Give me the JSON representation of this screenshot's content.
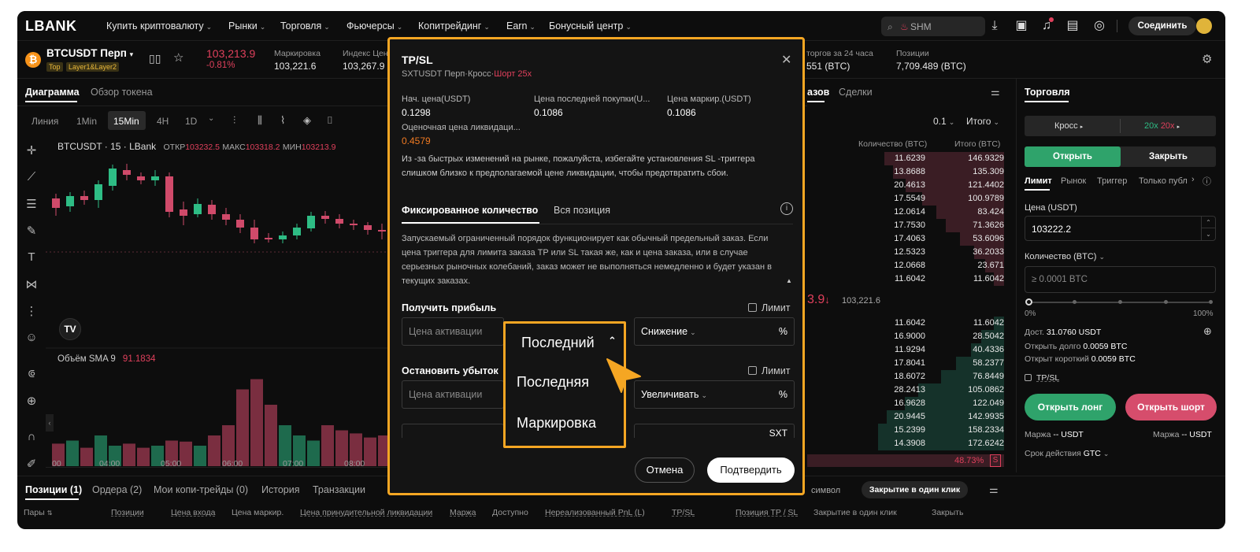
{
  "nav": {
    "logo": "LBANK",
    "items": [
      "Купить криптовалюту",
      "Рынки",
      "Торговля",
      "Фьючерсы",
      "Копитрейдинг",
      "Earn",
      "Бонусный центр"
    ],
    "search_text": "SHM",
    "connect_label": "Соединить"
  },
  "ticker": {
    "symbol": "BTCUSDT Перп",
    "tag_top": "Top",
    "tag_layer": "Layer1&Layer2",
    "price": "103,213.9",
    "change": "-0.81%",
    "mark_label": "Маркировка",
    "mark_value": "103,221.6",
    "index_label": "Индекс Цен",
    "index_value": "103,267.9",
    "vol_label": "торгов за 24 часа",
    "vol_value": "551 (BTC)",
    "pos_label": "Позиции",
    "pos_value": "7,709.489 (BTC)"
  },
  "chart": {
    "tabs": [
      "Диаграмма",
      "Обзор токена"
    ],
    "intervals": [
      "Линия",
      "1Min",
      "15Min",
      "4H",
      "1D"
    ],
    "active_interval": "15Min",
    "title": "BTCUSDT · 15 · LBank",
    "open_label": "ОТКР",
    "open_value": "103232.5",
    "high_label": "МАКС",
    "high_value": "103318.2",
    "low_label": "МИН",
    "low_value": "103213.9",
    "volume_label": "Объём SMA 9",
    "volume_value": "91.1834",
    "time_labels": [
      "00",
      "04:00",
      "05:00",
      "06:00",
      "07:00",
      "08:00"
    ]
  },
  "orderbook": {
    "tabs": [
      "азов",
      "Сделки"
    ],
    "precision": "0.1",
    "total_label": "Итого",
    "col_qty": "Количество (BTC)",
    "col_total": "Итого (BTC)",
    "asks": [
      [
        "11.6239",
        "146.9329",
        0.95
      ],
      [
        "13.8688",
        "135.309",
        0.88
      ],
      [
        "20.4613",
        "121.4402",
        0.78
      ],
      [
        "17.5549",
        "100.9789",
        0.65
      ],
      [
        "12.0614",
        "83.424",
        0.54
      ],
      [
        "17.7530",
        "71.3626",
        0.46
      ],
      [
        "17.4063",
        "53.6096",
        0.35
      ],
      [
        "12.5323",
        "36.2033",
        0.24
      ],
      [
        "12.0668",
        "23.671",
        0.15
      ],
      [
        "11.6042",
        "11.6042",
        0.08
      ]
    ],
    "last_price": "3.9",
    "last_price_arrow": "↓",
    "last_mark": "103,221.6",
    "bids": [
      [
        "11.6042",
        "11.6042",
        0.08
      ],
      [
        "16.9000",
        "28.5042",
        0.18
      ],
      [
        "11.9294",
        "40.4336",
        0.26
      ],
      [
        "17.8041",
        "58.2377",
        0.38
      ],
      [
        "18.6072",
        "76.8449",
        0.5
      ],
      [
        "28.2413",
        "105.0862",
        0.68
      ],
      [
        "16.9628",
        "122.049",
        0.79
      ],
      [
        "20.9445",
        "142.9935",
        0.93
      ],
      [
        "15.2399",
        "158.2334",
        1.0
      ],
      [
        "14.3908",
        "172.6242",
        1.0
      ]
    ],
    "ratio": "48.73%",
    "ratio_tag": "S"
  },
  "trade": {
    "title": "Торговля",
    "margin_mode": "Кросс",
    "leverage_long": "20x",
    "leverage_short": "20x",
    "open": "Открыть",
    "close": "Закрыть",
    "order_tabs": [
      "Лимит",
      "Рынок",
      "Триггер",
      "Только публ"
    ],
    "price_label": "Цена (USDT)",
    "price_value": "103222.2",
    "qty_label": "Количество (BTC)",
    "qty_placeholder": "≥ 0.0001 BTC",
    "slider_min": "0%",
    "slider_max": "100%",
    "available_label": "Дост.",
    "available_value": "31.0760 USDT",
    "open_long_label": "Открыть долго",
    "open_long_value": "0.0059 BTC",
    "open_short_label": "Открыт короткий",
    "open_short_value": "0.0059 BTC",
    "tpsl": "TP/SL",
    "btn_long": "Открыть лонг",
    "btn_short": "Открыть шорт",
    "margin_label": "Маржа",
    "margin_value": "--  USDT",
    "margin_label2": "Маржа",
    "margin_value2": "--  USDT",
    "tif_label": "Срок действия",
    "tif_value": "GTC"
  },
  "bottom": {
    "tabs": [
      "Позиции (1)",
      "Ордера (2)",
      "Мои копи-трейды (0)",
      "История",
      "Транзакции"
    ],
    "symbol_hint": "символ",
    "close_all": "Закрытие в один клик",
    "headers": [
      "Пары",
      "Позиции",
      "Цена входа",
      "Цена маркир.",
      "Цена принудительной ликвидации",
      "Маржа",
      "Доступно",
      "Нереализованный PnL (L)",
      "TP/SL",
      "Позиция TP / SL",
      "Закрытие в один клик",
      "Закрыть"
    ]
  },
  "modal": {
    "title": "TP/SL",
    "subtitle": "SXTUSDT Перп·Кросс·",
    "subtitle_side": "Шорт 25x",
    "start_price_label": "Нач. цена(USDT)",
    "start_price_value": "0.1298",
    "last_buy_label": "Цена последней покупки(U...",
    "last_buy_value": "0.1086",
    "mark_label": "Цена маркир.(USDT)",
    "mark_value": "0.1086",
    "liq_label": "Оценочная цена ликвидаци...",
    "liq_value": "0.4579",
    "warning_1": "Из -за быстрых изменений на рынке, пожалуйста, избегайте установления SL -триггера",
    "warning_2": "слишком близко к предполагаемой цене ликвидации, чтобы предотвратить сбои.",
    "tab_fixed": "Фиксированное количество",
    "tab_all": "Вся позиция",
    "info_1": "Запускаемый ограниченный порядок функционирует как обычный предельный заказ. Если",
    "info_2": "цена триггера для лимита заказа TP или SL такая же, как и цена заказа, или в случае",
    "info_3": "серьезных рыночных колебаний, заказ может не выполняться немедленно и будет указан в",
    "info_4": "текущих заказах.",
    "tp_label": "Получить прибыль",
    "limit_label": "Лимит",
    "activation_placeholder": "Цена активации",
    "dropdown_selected": "Последний",
    "decrease_label": "Снижение",
    "percent": "%",
    "sl_label": "Остановить убыток",
    "limit_label2": "Лимит",
    "activation_placeholder2": "Цена активации",
    "increase_label": "Увеличивать",
    "percent2": "%",
    "partial_right": "SXT",
    "dropdown_options": [
      "Последняя",
      "Маркировка"
    ],
    "cancel": "Отмена",
    "confirm": "Подтвердить"
  }
}
